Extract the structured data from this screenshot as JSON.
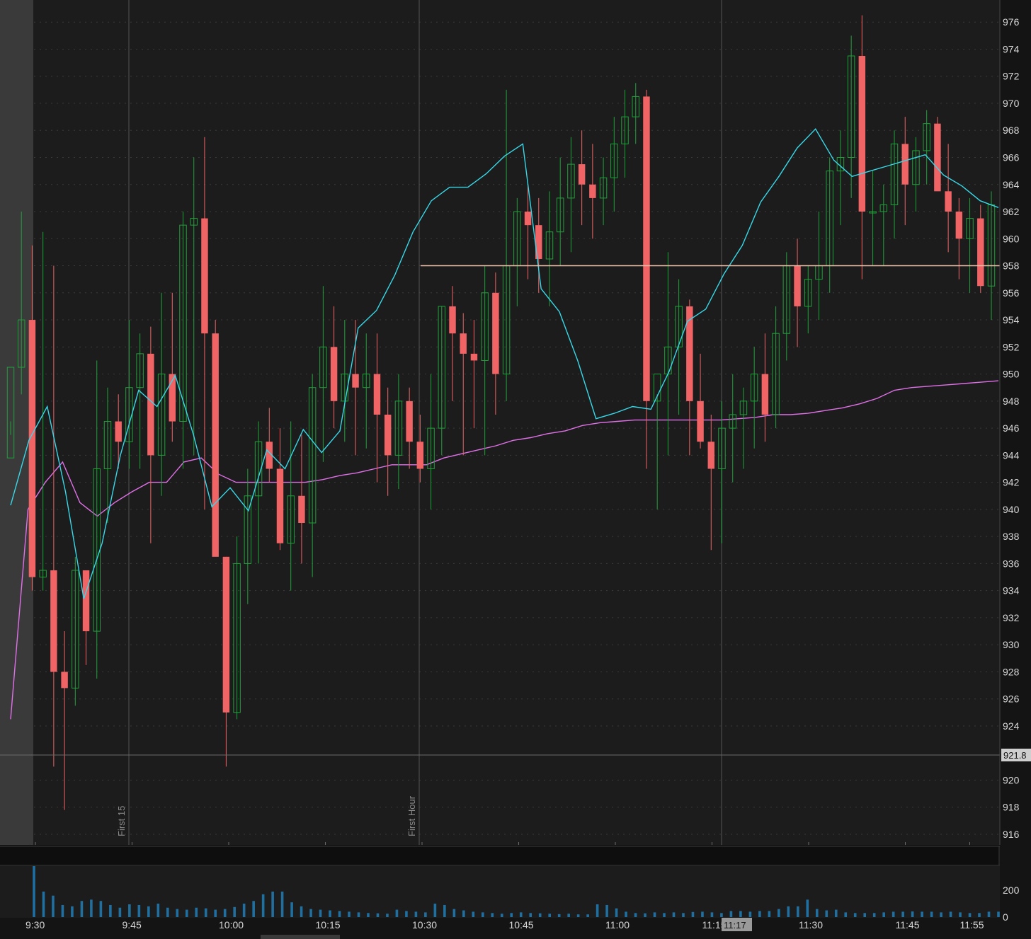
{
  "colors": {
    "background": "#1c1c1c",
    "premarket_shade": "#3a3a3a",
    "up_candle": "#1fa23a",
    "down_candle": "#f06466",
    "ema_line": "#38d8e8",
    "vwap_line": "#e070e8",
    "price_line": "#f0c0a8",
    "volume_bar": "#1f6fa0",
    "axis_text": "#d8d8d8"
  },
  "vertical_markers": [
    {
      "label": "First 15"
    },
    {
      "label": "First Hour"
    }
  ],
  "cursor_time_label": "11:17",
  "current_price_label": "921.8",
  "chart_data": {
    "type": "candlestick",
    "symbol": "",
    "y_axis": {
      "min": 915,
      "max": 977,
      "ticks": [
        "916",
        "918",
        "920",
        "924",
        "926",
        "928",
        "930",
        "932",
        "934",
        "936",
        "938",
        "940",
        "942",
        "944",
        "946",
        "948",
        "950",
        "952",
        "954",
        "956",
        "958",
        "960",
        "962",
        "964",
        "966",
        "968",
        "970",
        "972",
        "974",
        "976"
      ]
    },
    "x_axis": {
      "ticks": [
        {
          "label": "9:30",
          "minute": 0
        },
        {
          "label": "9:45",
          "minute": 15
        },
        {
          "label": "10:00",
          "minute": 30
        },
        {
          "label": "10:15",
          "minute": 45
        },
        {
          "label": "10:30",
          "minute": 60
        },
        {
          "label": "10:45",
          "minute": 75
        },
        {
          "label": "11:00",
          "minute": 90
        },
        {
          "label": "11:15",
          "minute": 105
        },
        {
          "label": "11:30",
          "minute": 120
        },
        {
          "label": "11:45",
          "minute": 135
        },
        {
          "label": "11:55",
          "minute": 145
        }
      ]
    },
    "horizontal_level": 958,
    "volume_axis": {
      "ticks": [
        "200",
        "0"
      ],
      "max": 380
    },
    "candles": [
      [
        943.8,
        946.5,
        945.5,
        950.5
      ],
      [
        950.5,
        962,
        948.5,
        954
      ],
      [
        954,
        959.5,
        934,
        935
      ],
      [
        935,
        960.5,
        934,
        935.5
      ],
      [
        935.5,
        958,
        921,
        928
      ],
      [
        928,
        931,
        917.8,
        926.8
      ],
      [
        926.8,
        936.5,
        925.5,
        935.5
      ],
      [
        935.5,
        935,
        928.5,
        931
      ],
      [
        931,
        951,
        927.5,
        943
      ],
      [
        943,
        949,
        939,
        946.5
      ],
      [
        946.5,
        948.5,
        943,
        945
      ],
      [
        945,
        954,
        943,
        949
      ],
      [
        949,
        953,
        943,
        951.5
      ],
      [
        951.5,
        953.5,
        937.5,
        944
      ],
      [
        944,
        956,
        941,
        950
      ],
      [
        950,
        956,
        945,
        946.5
      ],
      [
        946.5,
        962,
        943,
        961
      ],
      [
        961,
        966,
        944,
        961.5
      ],
      [
        961.5,
        967.5,
        940,
        953
      ],
      [
        953,
        954,
        937,
        936.5
      ],
      [
        936.5,
        936.5,
        921,
        925
      ],
      [
        925,
        938,
        924.5,
        936
      ],
      [
        936,
        943,
        933,
        941
      ],
      [
        941,
        946.5,
        936,
        945
      ],
      [
        945,
        947.5,
        942,
        943
      ],
      [
        943,
        946,
        937,
        937.5
      ],
      [
        937.5,
        946.5,
        934,
        941
      ],
      [
        941,
        945.5,
        936,
        939
      ],
      [
        939,
        950,
        935,
        949
      ],
      [
        949,
        956.5,
        943.5,
        952
      ],
      [
        952,
        955,
        946,
        948
      ],
      [
        948,
        954,
        945,
        950
      ],
      [
        950,
        954,
        944,
        949
      ],
      [
        949,
        953,
        944.5,
        950
      ],
      [
        950,
        953,
        942,
        947
      ],
      [
        947,
        949,
        941,
        944
      ],
      [
        944,
        950,
        941.5,
        948
      ],
      [
        948,
        949,
        943,
        945
      ],
      [
        945,
        947,
        942,
        943
      ],
      [
        943,
        950,
        940,
        946
      ],
      [
        946,
        955,
        944,
        955
      ],
      [
        955,
        956.5,
        948,
        953
      ],
      [
        953,
        954.5,
        944,
        951.5
      ],
      [
        951.5,
        954,
        946,
        951
      ],
      [
        951,
        958,
        944,
        956
      ],
      [
        956,
        957.5,
        947,
        950
      ],
      [
        950,
        971,
        948,
        958
      ],
      [
        958,
        963,
        955,
        962
      ],
      [
        962,
        964,
        957,
        961
      ],
      [
        961,
        963,
        956,
        958.5
      ],
      [
        958.5,
        963.5,
        955,
        960.5
      ],
      [
        960.5,
        966,
        958,
        963
      ],
      [
        963,
        967.5,
        959,
        965.5
      ],
      [
        965.5,
        968,
        961,
        964
      ],
      [
        964,
        967,
        960,
        963
      ],
      [
        963,
        966,
        961,
        964.5
      ],
      [
        964.5,
        969,
        962,
        967
      ],
      [
        967,
        971,
        964.5,
        969
      ],
      [
        969,
        971.5,
        967,
        970.5
      ],
      [
        970.5,
        971,
        943,
        948
      ],
      [
        948,
        948.5,
        940,
        950
      ],
      [
        950,
        959,
        944,
        952
      ],
      [
        952,
        957,
        947,
        955
      ],
      [
        955,
        955.5,
        944,
        948
      ],
      [
        948,
        951.5,
        944.5,
        945
      ],
      [
        945,
        947,
        937,
        943
      ],
      [
        943,
        948,
        937.5,
        946
      ],
      [
        946,
        950,
        942,
        947
      ],
      [
        947,
        949,
        943,
        948
      ],
      [
        948,
        952,
        944.5,
        950
      ],
      [
        950,
        953,
        945,
        947
      ],
      [
        947,
        955,
        946,
        953
      ],
      [
        953,
        959,
        951,
        958
      ],
      [
        958,
        960,
        952,
        955
      ],
      [
        955,
        958,
        953,
        957
      ],
      [
        957,
        962,
        954,
        958
      ],
      [
        958,
        966,
        956,
        965
      ],
      [
        965,
        968,
        961,
        966
      ],
      [
        966,
        975,
        963,
        973.5
      ],
      [
        973.5,
        976.5,
        957,
        962
      ],
      [
        962,
        965,
        958,
        962
      ],
      [
        962,
        964,
        958,
        962.5
      ],
      [
        962.5,
        968,
        960,
        967
      ],
      [
        967,
        969,
        961,
        964
      ],
      [
        964,
        967.5,
        962,
        966.5
      ],
      [
        966.5,
        969.5,
        964,
        968.5
      ],
      [
        968.5,
        969,
        965,
        963.5
      ],
      [
        963.5,
        967,
        959,
        962
      ],
      [
        962,
        963,
        957,
        960
      ],
      [
        960,
        963,
        956,
        961.5
      ],
      [
        961.5,
        962.5,
        956,
        956.5
      ],
      [
        956.5,
        963.5,
        954,
        962.5
      ]
    ],
    "ema": [
      940.3,
      945.1,
      947.6,
      941.3,
      933.4,
      937.5,
      944,
      948.8,
      947.6,
      949.9,
      945.5,
      940.2,
      941.6,
      939.9,
      944.4,
      943,
      945.9,
      944.2,
      945.8,
      953.4,
      954.7,
      957.3,
      960.5,
      962.8,
      963.8,
      963.8,
      964.8,
      966.1,
      967,
      956.3,
      954.6,
      951,
      946.7,
      947.1,
      947.6,
      947.4,
      950.2,
      953.9,
      954.8,
      957.4,
      959.5,
      962.7,
      964.6,
      966.7,
      968.1,
      965.8,
      964.6,
      965,
      965.4,
      965.8,
      966.2,
      964.7,
      963.9,
      962.8,
      962.3
    ],
    "vwap": [
      924.5,
      940,
      942,
      943.5,
      940.5,
      939.5,
      940.5,
      941.3,
      942,
      942,
      943.5,
      943.8,
      942.6,
      942,
      942,
      942,
      942,
      942,
      942.2,
      942.5,
      942.7,
      943,
      943.3,
      943.3,
      943.3,
      943.8,
      944.1,
      944.4,
      944.7,
      945.1,
      945.3,
      945.6,
      945.8,
      946.2,
      946.4,
      946.5,
      946.6,
      946.6,
      946.6,
      946.6,
      946.6,
      946.6,
      946.7,
      946.8,
      947,
      947,
      947.1,
      947.3,
      947.5,
      947.8,
      948.2,
      948.8,
      949,
      949.1,
      949.2,
      949.3,
      949.4,
      949.5
    ]
  },
  "volume_data": [
    380,
    190,
    160,
    90,
    80,
    120,
    130,
    120,
    90,
    70,
    95,
    90,
    80,
    100,
    70,
    60,
    55,
    70,
    65,
    55,
    60,
    75,
    100,
    120,
    170,
    190,
    190,
    110,
    80,
    60,
    55,
    50,
    45,
    40,
    35,
    30,
    28,
    25,
    55,
    45,
    40,
    35,
    100,
    90,
    60,
    50,
    40,
    35,
    30,
    25,
    30,
    35,
    30,
    28,
    25,
    22,
    25,
    20,
    20,
    95,
    90,
    65,
    40,
    30,
    28,
    35,
    30,
    35,
    30,
    38,
    40,
    35,
    30,
    45,
    45,
    40,
    45,
    45,
    60,
    80,
    80,
    130,
    60,
    50,
    55,
    35,
    30,
    30,
    30,
    35,
    40,
    40,
    42,
    40,
    40,
    35,
    40,
    35,
    30,
    30,
    40,
    40
  ]
}
